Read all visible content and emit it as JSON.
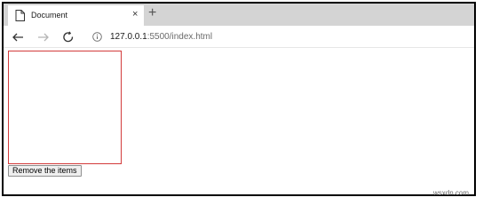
{
  "browser": {
    "tab": {
      "title": "Document",
      "close_glyph": "×",
      "icon": "document-icon"
    },
    "new_tab_glyph": "+",
    "toolbar": {
      "back_icon": "back-arrow-icon",
      "forward_icon": "forward-arrow-icon",
      "reload_icon": "reload-icon",
      "info_icon": "info-icon",
      "url_host": "127.0.0.1",
      "url_path": ":5500/index.html"
    }
  },
  "page": {
    "list_border_color": "#d33b3b",
    "remove_button_label": "Remove the items"
  },
  "watermark": "wsxdn.com"
}
